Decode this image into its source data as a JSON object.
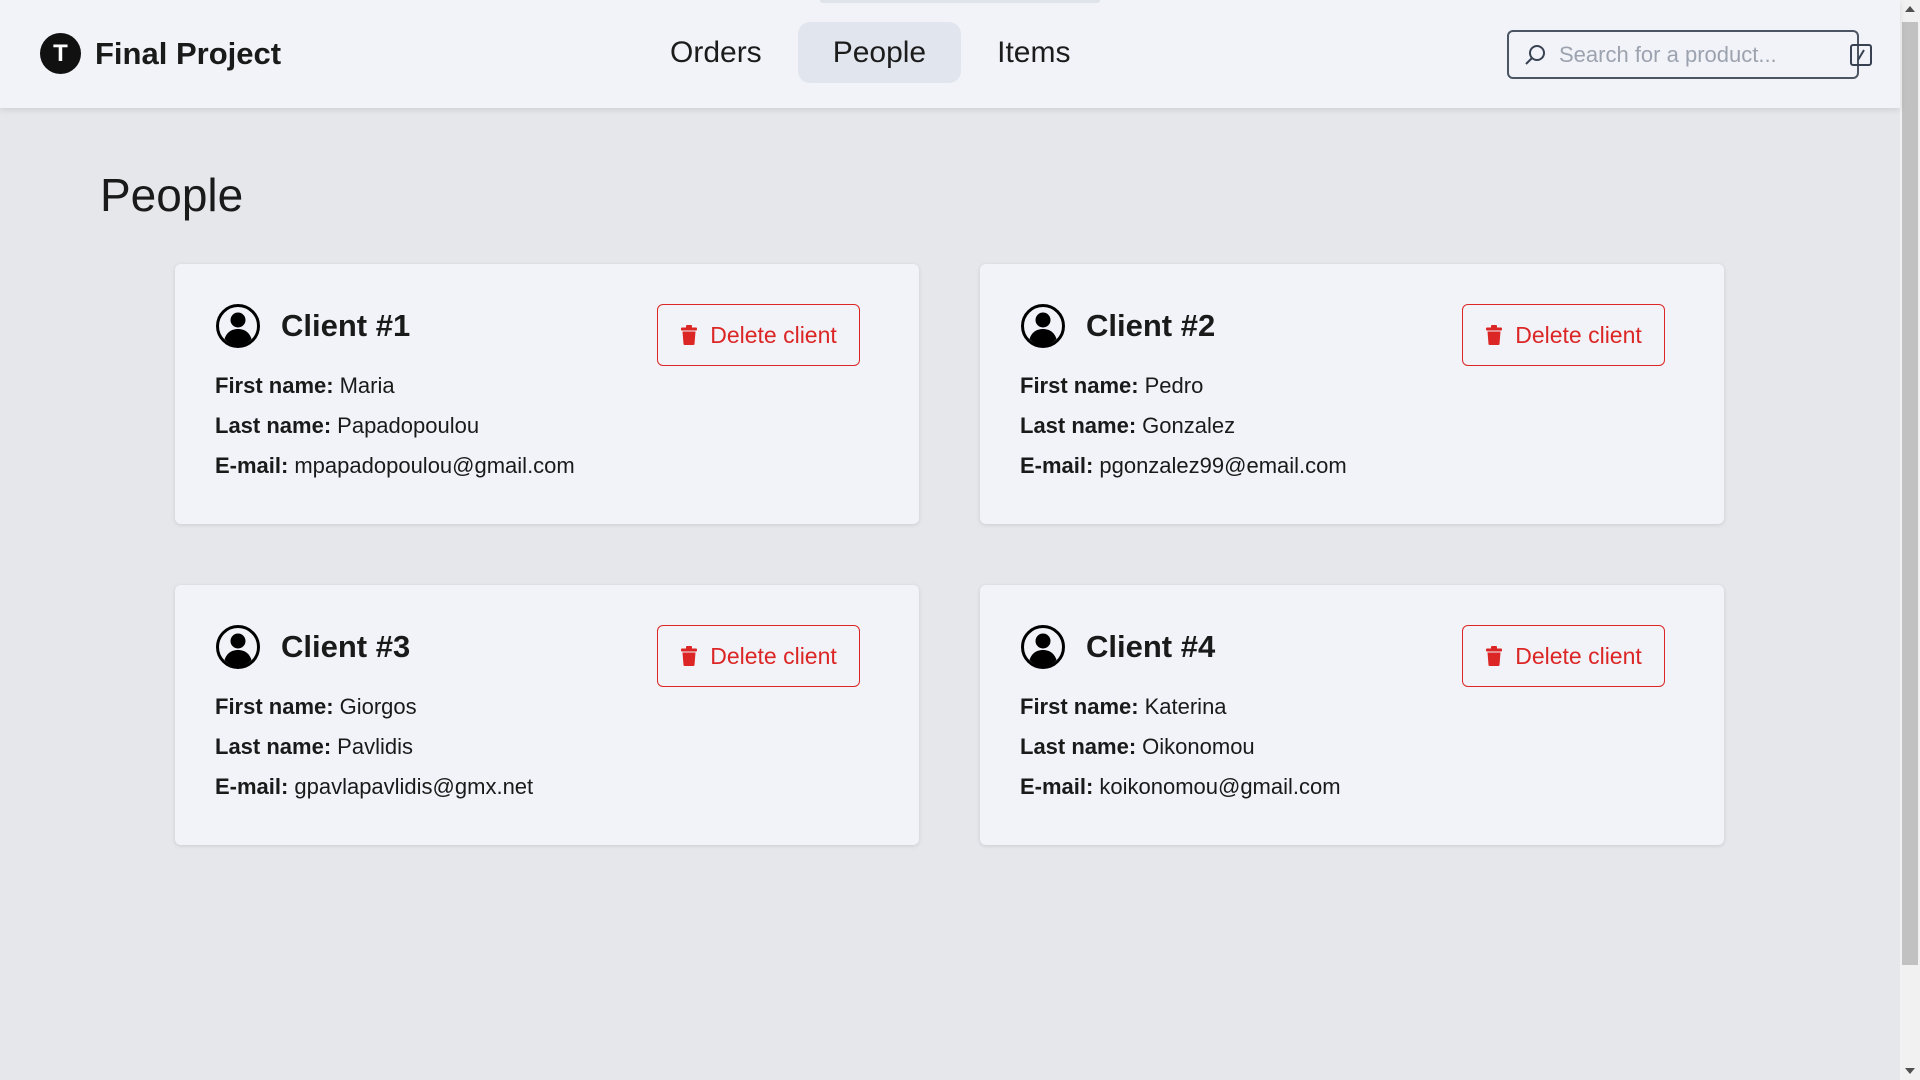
{
  "header": {
    "brand": {
      "logo_letter": "T",
      "name": "Final Project"
    },
    "nav": [
      {
        "label": "Orders",
        "active": false
      },
      {
        "label": "People",
        "active": true
      },
      {
        "label": "Items",
        "active": false
      }
    ],
    "search": {
      "placeholder": "Search for a product...",
      "value": ""
    }
  },
  "main": {
    "title": "People",
    "clients": [
      {
        "title": "Client #1",
        "first_name_label": "First name:",
        "first_name": "Maria",
        "last_name_label": "Last name:",
        "last_name": "Papadopoulou",
        "email_label": "E-mail:",
        "email": "mpapadopoulou@gmail.com",
        "delete_label": "Delete client"
      },
      {
        "title": "Client #2",
        "first_name_label": "First name:",
        "first_name": "Pedro",
        "last_name_label": "Last name:",
        "last_name": "Gonzalez",
        "email_label": "E-mail:",
        "email": "pgonzalez99@email.com",
        "delete_label": "Delete client"
      },
      {
        "title": "Client #3",
        "first_name_label": "First name:",
        "first_name": "Giorgos",
        "last_name_label": "Last name:",
        "last_name": "Pavlidis",
        "email_label": "E-mail:",
        "email": "gpavlapavlidis@gmx.net",
        "delete_label": "Delete client"
      },
      {
        "title": "Client #4",
        "first_name_label": "First name:",
        "first_name": "Katerina",
        "last_name_label": "Last name:",
        "last_name": "Oikonomou",
        "email_label": "E-mail:",
        "email": "koikonomou@gmail.com",
        "delete_label": "Delete client"
      }
    ]
  },
  "colors": {
    "danger": "#dc2626",
    "header_bg": "#f1f3f8",
    "page_bg": "#e5e7eb",
    "active_tab_bg": "#e1e6ee"
  },
  "icons": {
    "brand": "logo-icon",
    "search": "search-icon",
    "shortcut": "keyboard-shortcut-icon",
    "client": "user-circle-icon",
    "delete": "trash-icon"
  }
}
